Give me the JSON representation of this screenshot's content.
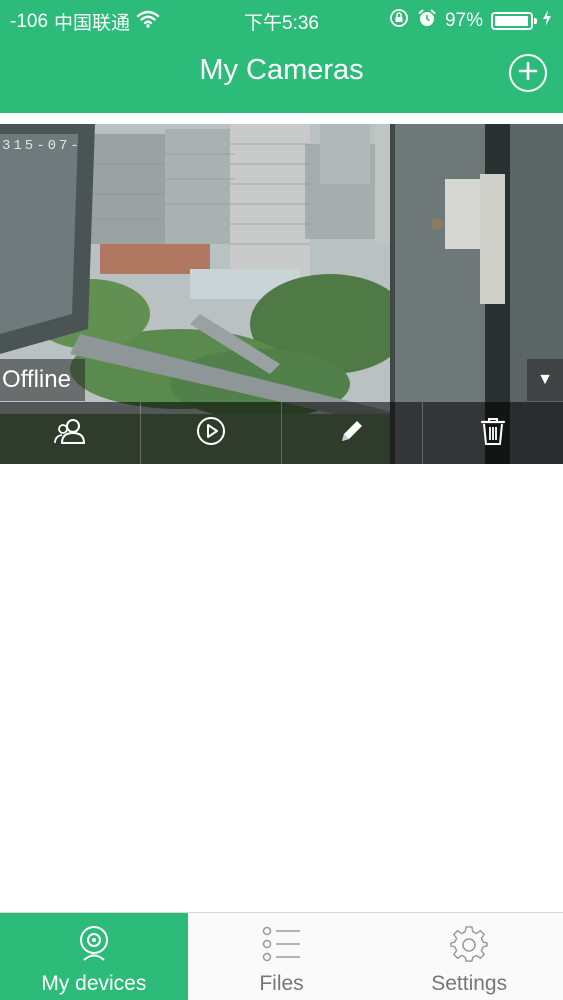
{
  "status_bar": {
    "signal": "-106",
    "carrier": "中国联通",
    "time": "下午5:36",
    "battery_percent": "97%",
    "battery_level": 0.97,
    "icons": [
      "wifi-icon",
      "rotation-lock-icon",
      "alarm-icon",
      "battery-icon",
      "charging-icon"
    ]
  },
  "header": {
    "title": "My Cameras",
    "add_icon": "plus-circle-icon"
  },
  "camera": {
    "timestamp": "315-07-",
    "status": "Offline",
    "actions": [
      {
        "name": "share",
        "icon": "users-icon"
      },
      {
        "name": "playback",
        "icon": "play-circle-icon"
      },
      {
        "name": "edit",
        "icon": "pencil-icon"
      },
      {
        "name": "delete",
        "icon": "trash-icon"
      }
    ]
  },
  "tabbar": {
    "tabs": [
      {
        "label": "My devices",
        "icon": "webcam-icon",
        "active": true
      },
      {
        "label": "Files",
        "icon": "list-icon",
        "active": false
      },
      {
        "label": "Settings",
        "icon": "gear-icon",
        "active": false
      }
    ]
  },
  "colors": {
    "accent": "#2dbb7a"
  }
}
